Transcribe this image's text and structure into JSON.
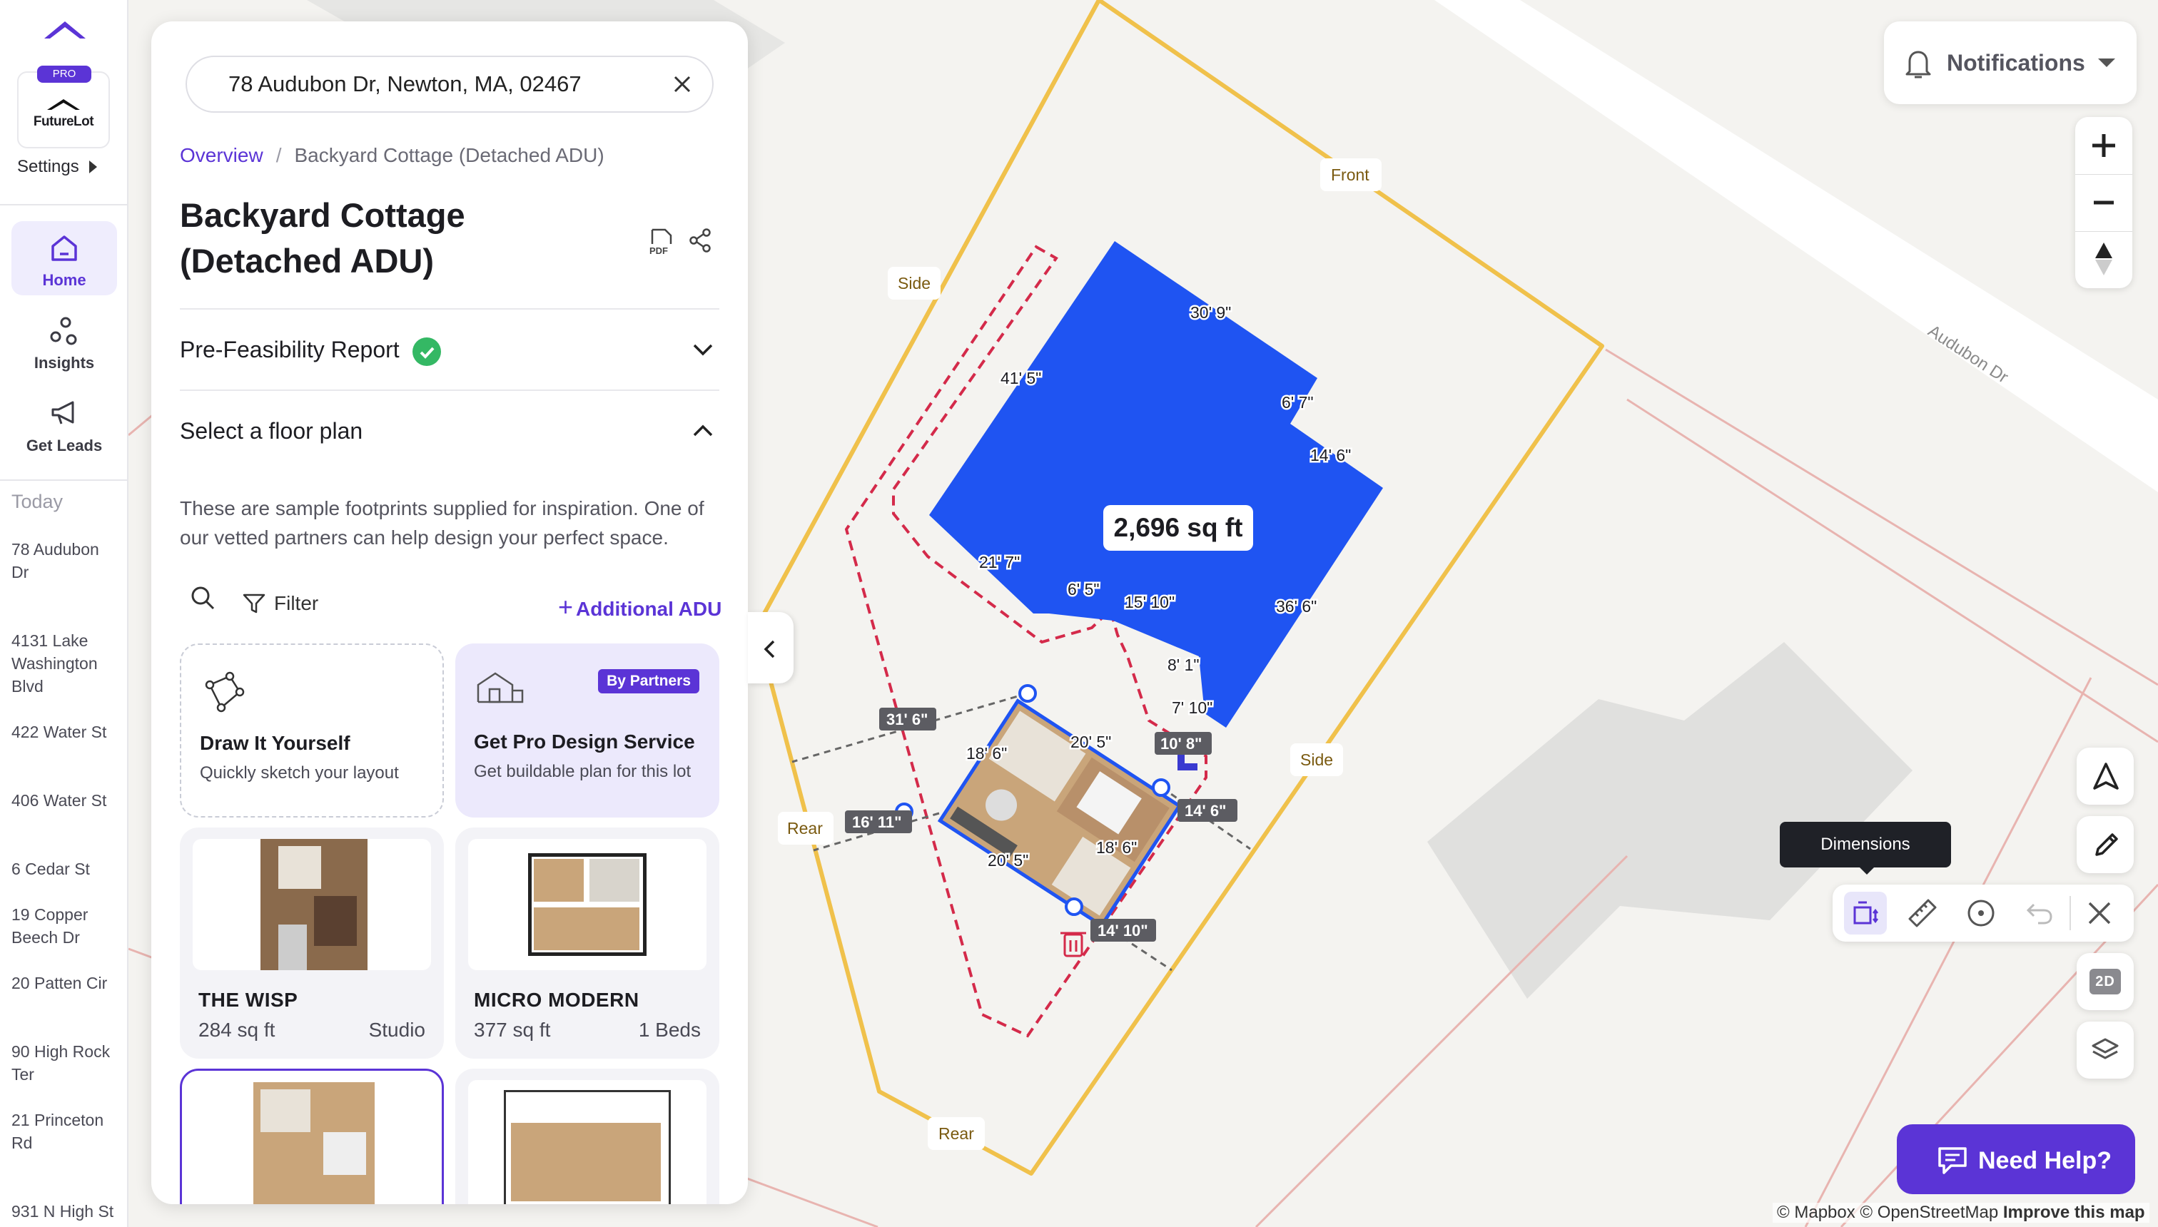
{
  "sidebar": {
    "pro_badge": "PRO",
    "brand": "FutureLot",
    "settings": "Settings",
    "nav": [
      {
        "label": "Home",
        "icon": "home-icon",
        "active": true
      },
      {
        "label": "Insights",
        "icon": "insights-icon",
        "active": false
      },
      {
        "label": "Get Leads",
        "icon": "megaphone-icon",
        "active": false
      }
    ],
    "history_heading": "Today",
    "history": [
      "78 Audubon Dr",
      "4131 Lake Washington Blvd",
      "422 Water St",
      "406 Water St",
      "6 Cedar St",
      "19 Copper Beech Dr",
      "20 Patten Cir",
      "90 High Rock Ter",
      "21 Princeton Rd",
      "931 N High St"
    ]
  },
  "panel": {
    "search_value": "78 Audubon Dr, Newton, MA, 02467",
    "breadcrumb": {
      "overview": "Overview",
      "separator": "/",
      "current": "Backyard Cottage (Detached ADU)"
    },
    "title": "Backyard Cottage (Detached ADU)",
    "pdf_label": "PDF",
    "prefeasibility": "Pre-Feasibility Report",
    "select_plan": "Select a floor plan",
    "description": "These are sample footprints supplied for inspiration. One of our vetted partners can help design your perfect space.",
    "filter": "Filter",
    "additional_adu": "Additional ADU",
    "draw_card": {
      "title": "Draw It Yourself",
      "subtitle": "Quickly sketch your layout"
    },
    "pro_card": {
      "badge": "By Partners",
      "title": "Get Pro Design Service",
      "subtitle": "Get buildable plan for this lot"
    },
    "plans": [
      {
        "name": "THE WISP",
        "sqft": "284 sq ft",
        "beds": "Studio"
      },
      {
        "name": "MICRO MODERN",
        "sqft": "377 sq ft",
        "beds": "1 Beds"
      }
    ]
  },
  "map": {
    "area_label": "2,696 sq ft",
    "street": "Audubon Dr",
    "lot_labels": {
      "front": "Front",
      "side": "Side",
      "rear": "Rear"
    },
    "house_dims": [
      "30' 9\"",
      "41' 5\"",
      "6' 7\"",
      "14' 6\"",
      "21' 7\"",
      "6' 5\"",
      "15' 10\"",
      "36' 6\"",
      "8' 1\"",
      "7' 10\""
    ],
    "adu_dims": [
      "18' 6\"",
      "20' 5\""
    ],
    "setbacks": [
      "31' 6\"",
      "16' 11\"",
      "10' 8\"",
      "14' 6\"",
      "14' 10\""
    ]
  },
  "controls": {
    "notifications": "Notifications",
    "tooltip": "Dimensions",
    "view_toggle": "2D",
    "help": "Need Help?",
    "attribution": {
      "mapbox": "© Mapbox",
      "osm": "© OpenStreetMap",
      "improve": "Improve this map"
    }
  },
  "colors": {
    "accent": "#5b34d6",
    "building": "#1f54f2",
    "lot_line": "#f0c14b",
    "buildable": "#d42a4a"
  }
}
